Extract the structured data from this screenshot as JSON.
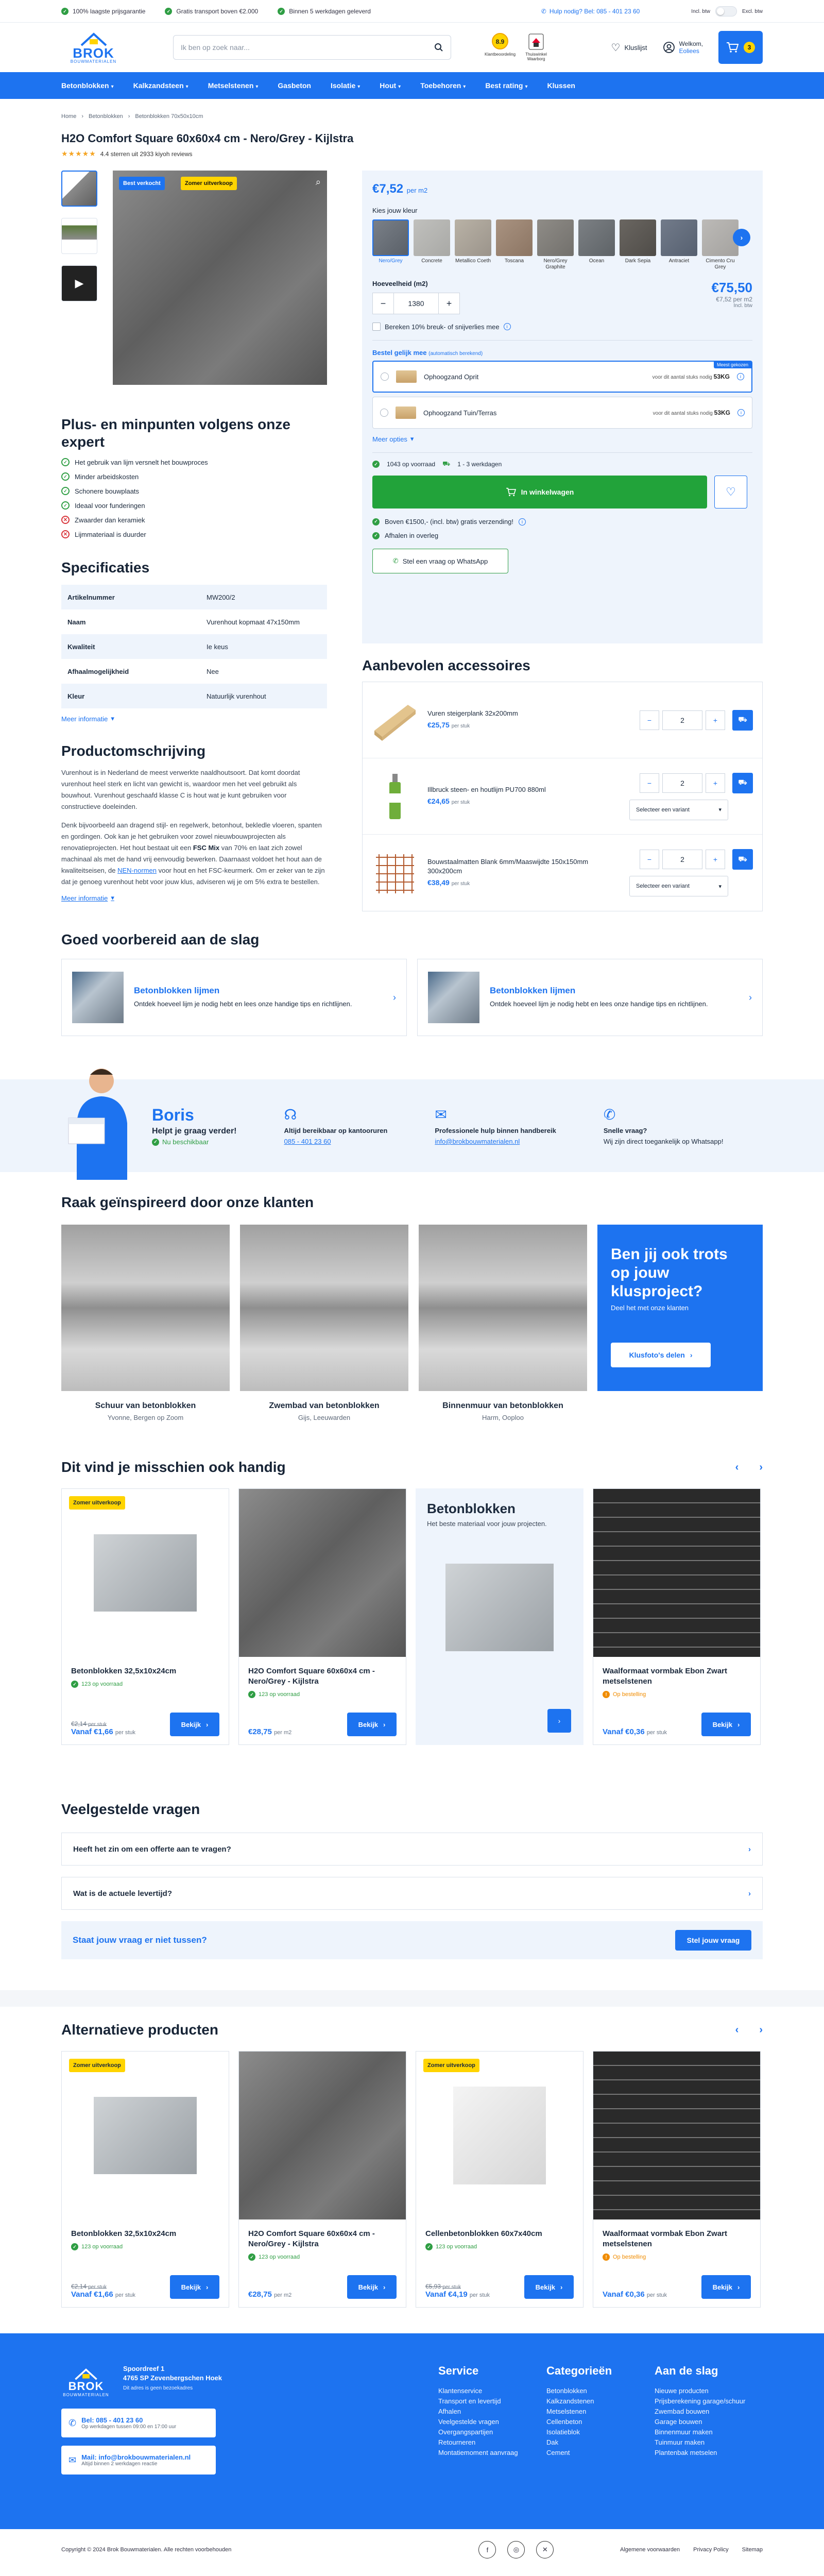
{
  "topbar": {
    "usps": [
      "100% laagste prijsgarantie",
      "Gratis transport boven €2.000",
      "Binnen 5 werkdagen geleverd"
    ],
    "phone": "Hulp nodig? Bel: 085 - 401 23 60",
    "incl": "Incl. btw",
    "excl": "Excl. btw"
  },
  "header": {
    "logo_name": "BROK",
    "logo_sub": "BOUWMATERIALEN",
    "search_placeholder": "Ik ben op zoek naar...",
    "badge1": "Klantbeoordeling",
    "badge2": "Thuiswinkel Waarborg",
    "wishlist": "Kluslijst",
    "account_hello": "Welkom,",
    "account_name": "Eoliees",
    "cart_count": "3"
  },
  "nav": [
    "Betonblokken",
    "Kalkzandsteen",
    "Metselstenen",
    "Gasbeton",
    "Isolatie",
    "Hout",
    "Toebehoren",
    "Best rating",
    "Klussen"
  ],
  "breadcrumb": [
    "Home",
    "Betonblokken",
    "Betonblokken 70x50x10cm"
  ],
  "product": {
    "title": "H2O Comfort Square 60x60x4 cm - Nero/Grey - Kijlstra",
    "rating": "4.4 sterren uit 2933 kiyoh reviews",
    "stars": "★★★★★",
    "tag_best": "Best verkocht",
    "tag_summer": "Zomer uitverkoop"
  },
  "pros_cons": {
    "title": "Plus- en minpunten volgens onze expert",
    "pros": [
      "Het gebruik van lijm versnelt het bouwproces",
      "Minder arbeidskosten",
      "Schonere bouwplaats",
      "Ideaal voor funderingen"
    ],
    "cons": [
      "Zwaarder dan keramiek",
      "Lijmmateriaal is duurder"
    ]
  },
  "specs": {
    "title": "Specificaties",
    "rows": [
      [
        "Artikelnummer",
        "MW200/2"
      ],
      [
        "Naam",
        "Vurenhout kopmaat 47x150mm"
      ],
      [
        "Kwaliteit",
        "Ie keus"
      ],
      [
        "Afhaalmogelijkheid",
        "Nee"
      ],
      [
        "Kleur",
        "Natuurlijk vurenhout"
      ]
    ],
    "more": "Meer informatie"
  },
  "description": {
    "title": "Productomschrijving",
    "p1": "Vurenhout is in Nederland de meest verwerkte naaldhoutsoort. Dat komt doordat vurenhout heel sterk en licht van gewicht is, waardoor men het veel gebruikt als bouwhout. Vurenhout geschaafd klasse C is hout wat je kunt gebruiken voor constructieve doeleinden.",
    "p2a": "Denk bijvoorbeeld aan dragend stijl- en regelwerk, betonhout, bekledle vloeren, spanten en gordingen. Ook kan je het gebruiken voor zowel nieuwbouwprojecten als renovatieprojecten. Het hout bestaat uit een ",
    "p2b": "FSC Mix",
    "p2c": " van 70% en laat zich zowel machinaal als met de hand vrij eenvoudig bewerken. Daarnaast voldoet het hout aan de kwaliteitseisen, de ",
    "p2d": "NEN-normen",
    "p2e": " voor hout en het FSC-keurmerk. Om er zeker van te zijn dat je genoeg vurenhout hebt voor jouw klus, adviseren wij je om 5% extra te bestellen.",
    "more": "Meer informatie"
  },
  "buybox": {
    "price": "€7,52",
    "price_unit": "per m2",
    "color_label": "Kies jouw kleur",
    "colors": [
      {
        "name": "Nero/Grey",
        "c1": "#7a8088",
        "c2": "#5a6068",
        "sel": true
      },
      {
        "name": "Concrete",
        "c1": "#c0c0bd",
        "c2": "#a9a9a6"
      },
      {
        "name": "Metallico Coeth",
        "c1": "#b9b2a6",
        "c2": "#9b948b"
      },
      {
        "name": "Toscana",
        "c1": "#a99381",
        "c2": "#8c7563"
      },
      {
        "name": "Nero/Grey Graphite",
        "c1": "#8f8c87",
        "c2": "#72706c"
      },
      {
        "name": "Ocean",
        "c1": "#7c8084",
        "c2": "#5e6367"
      },
      {
        "name": "Dark Sepia",
        "c1": "#6a6661",
        "c2": "#4f4c48"
      },
      {
        "name": "Antraciet",
        "c1": "#727b8a",
        "c2": "#566070"
      },
      {
        "name": "Cimento Cru Grey",
        "c1": "#bcbab7",
        "c2": "#a4a29f"
      }
    ],
    "qty_label": "Hoeveelheid (m2)",
    "qty": "1380",
    "total": "€75,50",
    "total_unit": "€7,52 per m2",
    "total_note": "Incl. btw",
    "breakage": "Bereken 10% breuk- of snijverlies mee",
    "options_title": "Bestel gelijk mee",
    "options_sub": "(automatisch berekend)",
    "options": [
      {
        "name": "Ophoogzand Oprit",
        "note": "voor dit aantal stuks nodig",
        "amount": "53KG",
        "flag": "Meest gekozen",
        "sel": true
      },
      {
        "name": "Ophoogzand Tuin/Terras",
        "note": "voor dit aantal stuks nodig",
        "amount": "53KG"
      }
    ],
    "more_options": "Meer opties",
    "stock": "1043 op voorraad",
    "delivery": "1 - 3 werkdagen",
    "add_to_cart": "In winkelwagen",
    "perk1": "Boven €1500,- (incl. btw) gratis verzending!",
    "perk2": "Afhalen in overleg",
    "whatsapp": "Stel een vraag op WhatsApp"
  },
  "accessories": {
    "title": "Aanbevolen accessoires",
    "items": [
      {
        "name": "Vuren steigerplank 32x200mm",
        "price": "€25,75",
        "unit": "per stuk",
        "qty": "2"
      },
      {
        "name": "Illbruck steen- en houtlijm PU700 880ml",
        "price": "€24,65",
        "unit": "per stuk",
        "qty": "2",
        "variant": "Selecteer een variant"
      },
      {
        "name": "Bouwstaalmatten Blank 6mm/Maaswijdte 150x150mm 300x200cm",
        "price": "€38,49",
        "unit": "per stuk",
        "qty": "2",
        "variant": "Selecteer een variant"
      }
    ]
  },
  "guides": {
    "title": "Goed voorbereid aan de slag",
    "items": [
      {
        "title": "Betonblokken lijmen",
        "desc": "Ontdek hoeveel lijm je nodig hebt en lees onze handige tips en richtlijnen."
      },
      {
        "title": "Betonblokken lijmen",
        "desc": "Ontdek hoeveel lijm je nodig hebt en lees onze handige tips en richtlijnen."
      }
    ]
  },
  "service": {
    "name": "Boris",
    "sub": "Helpt je graag verder!",
    "available": "Nu beschikbaar",
    "cols": [
      {
        "title": "Altijd bereikbaar op kantooruren",
        "link": "085 - 401 23 60"
      },
      {
        "title": "Professionele hulp binnen handbereik",
        "link": "info@brokbouwmaterialen.nl"
      },
      {
        "title": "Snelle vraag?",
        "text": "Wij zijn direct toegankelijk op Whatsapp!"
      }
    ]
  },
  "inspiration": {
    "title": "Raak geïnspireerd door onze klanten",
    "items": [
      {
        "title": "Schuur van betonblokken",
        "sub": "Yvonne, Bergen op Zoom"
      },
      {
        "title": "Zwembad van betonblokken",
        "sub": "Gijs, Leeuwarden"
      },
      {
        "title": "Binnenmuur van betonblokken",
        "sub": "Harm, Ooploo"
      }
    ],
    "cta_title": "Ben jij ook trots op jouw klusproject?",
    "cta_sub": "Deel het met onze klanten",
    "cta_btn": "Klusfoto's delen"
  },
  "handy": {
    "title": "Dit vind je misschien ook handig",
    "cards": [
      {
        "name": "Betonblokken 32,5x10x24cm",
        "tag": "Zomer uitverkoop",
        "stock": "123 op voorraad",
        "old": "€2,14",
        "old_unit": "per stuk",
        "price": "Vanaf €1,66",
        "unit": "per stuk",
        "img": "block"
      },
      {
        "name": "H2O Comfort Square 60x60x4 cm - Nero/Grey - Kijlstra",
        "stock": "123 op voorraad",
        "price": "€28,75",
        "unit": "per m2",
        "img": "tile"
      },
      {
        "promo": true,
        "title": "Betonblokken",
        "sub": "Het beste materiaal voor jouw projecten."
      },
      {
        "name": "Waalformaat vormbak Ebon Zwart metselstenen",
        "stock": "Op bestelling",
        "price": "Vanaf €0,36",
        "unit": "per stuk",
        "img": "brick"
      }
    ],
    "btn": "Bekijk"
  },
  "faq": {
    "title": "Veelgestelde vragen",
    "items": [
      "Heeft het zin om een offerte aan te vragen?",
      "Wat is de actuele levertijd?"
    ],
    "ask": "Staat jouw vraag er niet tussen?",
    "ask_btn": "Stel jouw vraag"
  },
  "alternatives": {
    "title": "Alternatieve producten",
    "cards": [
      {
        "name": "Betonblokken 32,5x10x24cm",
        "tag": "Zomer uitverkoop",
        "stock": "123 op voorraad",
        "old": "€2,14",
        "old_unit": "per stuk",
        "price": "Vanaf €1,66",
        "unit": "per stuk",
        "img": "block"
      },
      {
        "name": "H2O Comfort Square 60x60x4 cm - Nero/Grey - Kijlstra",
        "stock": "123 op voorraad",
        "price": "€28,75",
        "unit": "per m2",
        "img": "tile"
      },
      {
        "name": "Cellenbetonblokken 60x7x40cm",
        "tag": "Zomer uitverkoop",
        "stock": "123 op voorraad",
        "old": "€5,93",
        "old_unit": "per stuk",
        "price": "Vanaf €4,19",
        "unit": "per stuk",
        "img": "cell"
      },
      {
        "name": "Waalformaat vormbak Ebon Zwart metselstenen",
        "stock": "Op bestelling",
        "price": "Vanaf €0,36",
        "unit": "per stuk",
        "img": "brick"
      }
    ]
  },
  "footer": {
    "address1": "Spoordreef 1",
    "address2": "4765 SP Zevenbergschen Hoek",
    "address3": "Dit adres is geen bezoekadres",
    "phone": "Bel: 085 - 401 23 60",
    "phone_sub": "Op werkdagen tussen 09:00 en 17:00 uur",
    "mail": "Mail: info@brokbouwmaterialen.nl",
    "mail_sub": "Altijd binnen 2 werkdagen reactie",
    "cols": [
      {
        "title": "Service",
        "links": [
          "Klantenservice",
          "Transport en levertijd",
          "Afhalen",
          "Veelgestelde vragen",
          "Overgangspartijen",
          "Retourneren",
          "Montatiemoment aanvraag"
        ]
      },
      {
        "title": "Categorieën",
        "links": [
          "Betonblokken",
          "Kalkzandstenen",
          "Metselstenen",
          "Cellenbeton",
          "Isolatieblok",
          "Dak",
          "Cement"
        ]
      },
      {
        "title": "Aan de slag",
        "links": [
          "Nieuwe producten",
          "Prijsberekening garage/schuur",
          "Zwembad bouwen",
          "Garage bouwen",
          "Binnenmuur maken",
          "Tuinmuur maken",
          "Plantenbak metselen"
        ]
      }
    ],
    "copyright": "Copyright © 2024 Brok Bouwmaterialen. Alle rechten voorbehouden",
    "bottom_links": [
      "Algemene voorwaarden",
      "Privacy Policy",
      "Sitemap"
    ]
  },
  "colors": {
    "accent": "#1d73f0",
    "cta": "#22a33a",
    "sale": "#ffd400",
    "light": "#eef4fc"
  }
}
